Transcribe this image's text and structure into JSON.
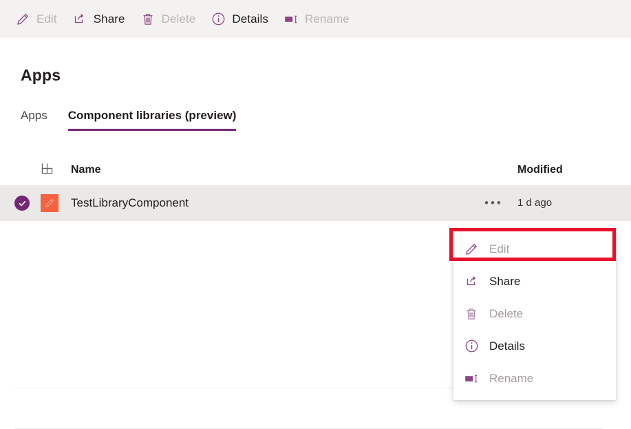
{
  "command_bar": {
    "items": [
      {
        "label": "Edit",
        "icon": "pencil-icon",
        "enabled": false
      },
      {
        "label": "Share",
        "icon": "share-icon",
        "enabled": true
      },
      {
        "label": "Delete",
        "icon": "trash-icon",
        "enabled": false
      },
      {
        "label": "Details",
        "icon": "info-icon",
        "enabled": true
      },
      {
        "label": "Rename",
        "icon": "rename-icon",
        "enabled": false
      }
    ]
  },
  "page": {
    "title": "Apps"
  },
  "tabs": [
    {
      "label": "Apps",
      "active": false
    },
    {
      "label": "Component libraries (preview)",
      "active": true
    }
  ],
  "table": {
    "headers": {
      "icon": "component-grid-icon",
      "name": "Name",
      "modified": "Modified"
    },
    "rows": [
      {
        "selected": true,
        "select_icon": "checkmark-circle-icon",
        "app_icon": "pencil-app-tile-icon",
        "name": "TestLibraryComponent",
        "menu_icon": "ellipsis-icon",
        "modified": "1 d ago"
      }
    ]
  },
  "context_menu": {
    "items": [
      {
        "label": "Edit",
        "icon": "pencil-icon",
        "enabled": false
      },
      {
        "label": "Share",
        "icon": "share-icon",
        "enabled": true
      },
      {
        "label": "Delete",
        "icon": "trash-icon",
        "enabled": false
      },
      {
        "label": "Details",
        "icon": "info-icon",
        "enabled": true
      },
      {
        "label": "Rename",
        "icon": "rename-icon",
        "enabled": false
      }
    ]
  },
  "colors": {
    "accent_purple": "#742774",
    "app_tile_orange": "#f4623f",
    "highlight_red": "#e8112d",
    "command_bar_bg": "#f3f2f1",
    "selected_row_bg": "#ebe9e7"
  }
}
